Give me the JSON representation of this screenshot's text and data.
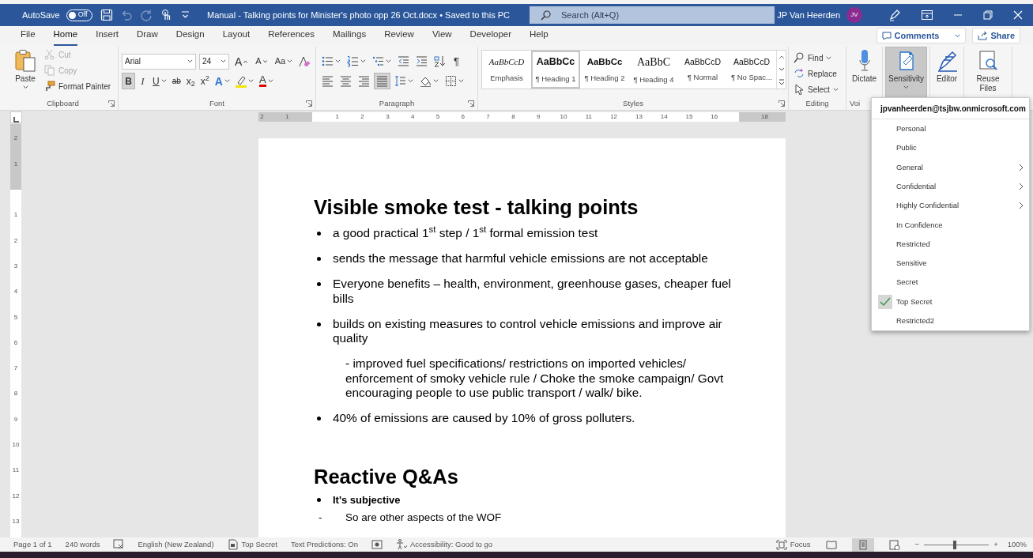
{
  "title_bar": {
    "autosave_label": "AutoSave",
    "autosave_toggle": {
      "label": "Off",
      "on": false
    },
    "quick_access": [
      {
        "kind": "save",
        "disabled": false
      },
      {
        "kind": "undo",
        "disabled": true
      },
      {
        "kind": "redo",
        "disabled": true
      },
      {
        "kind": "touch",
        "disabled": false
      },
      {
        "kind": "customize",
        "disabled": false
      }
    ],
    "document_title": "Manual - Talking points for Minister's photo opp 26 Oct.docx • Saved to this PC",
    "search": {
      "placeholder": "Search (Alt+Q)"
    },
    "user_name": "JP Van Heerden",
    "avatar_initials": "JV"
  },
  "tabs": [
    {
      "label": "File",
      "selected": false
    },
    {
      "label": "Home",
      "selected": true
    },
    {
      "label": "Insert",
      "selected": false
    },
    {
      "label": "Draw",
      "selected": false
    },
    {
      "label": "Design",
      "selected": false
    },
    {
      "label": "Layout",
      "selected": false
    },
    {
      "label": "References",
      "selected": false
    },
    {
      "label": "Mailings",
      "selected": false
    },
    {
      "label": "Review",
      "selected": false
    },
    {
      "label": "View",
      "selected": false
    },
    {
      "label": "Developer",
      "selected": false
    },
    {
      "label": "Help",
      "selected": false
    }
  ],
  "header_buttons": [
    {
      "kind": "comments",
      "label": "Comments"
    },
    {
      "kind": "share",
      "label": "Share"
    }
  ],
  "ribbon": {
    "clipboard": {
      "label": "Clipboard",
      "paste": "Paste",
      "items": [
        {
          "kind": "cut",
          "label": "Cut",
          "disabled": true
        },
        {
          "kind": "copy",
          "label": "Copy",
          "disabled": true
        },
        {
          "kind": "painter",
          "label": "Format Painter",
          "disabled": false
        }
      ]
    },
    "font": {
      "label": "Font",
      "font_name": "Arial",
      "font_size": "24",
      "size_buttons": [
        {
          "kind": "grow",
          "label": "A"
        },
        {
          "kind": "shrink",
          "label": "A"
        },
        {
          "kind": "case",
          "label": "Aa"
        }
      ],
      "buttons": [
        {
          "kind": "bold",
          "label": "B",
          "selected": true
        },
        {
          "kind": "italic",
          "label": "I",
          "selected": false
        },
        {
          "kind": "underline",
          "label": "U",
          "selected": false
        },
        {
          "kind": "strike",
          "label": "ab",
          "selected": false
        },
        {
          "kind": "subscript",
          "label": "x$_{2}$",
          "selected": false
        },
        {
          "kind": "superscript",
          "label": "x$^{2}$",
          "selected": false
        },
        {
          "kind": "effects",
          "label": "A",
          "selected": false
        },
        {
          "kind": "highlight",
          "selected": false
        },
        {
          "kind": "color",
          "label": "A",
          "selected": false
        }
      ]
    },
    "paragraph": {
      "label": "Paragraph",
      "buttons": [
        {
          "kind": "bullets",
          "selected": false
        },
        {
          "kind": "numbering",
          "selected": false
        },
        {
          "kind": "multilevel",
          "selected": false
        },
        {
          "kind": "outdent",
          "selected": false
        },
        {
          "kind": "indent",
          "selected": false
        },
        {
          "kind": "sort",
          "selected": false
        },
        {
          "kind": "pilcrow",
          "label": "¶",
          "selected": false
        },
        {
          "kind": "left",
          "selected": false
        },
        {
          "kind": "center",
          "selected": false
        },
        {
          "kind": "right",
          "selected": false
        },
        {
          "kind": "justify",
          "selected": true
        },
        {
          "kind": "spacing",
          "selected": false
        },
        {
          "kind": "shading",
          "selected": false
        },
        {
          "kind": "borders",
          "selected": false
        }
      ]
    },
    "styles": {
      "label": "Styles",
      "items": [
        {
          "kind": "emphasis",
          "preview": "AaBbCcD",
          "name": "Emphasis",
          "selected": false
        },
        {
          "kind": "heading1",
          "preview": "AaBbCc",
          "name": "¶ Heading 1",
          "selected": true
        },
        {
          "kind": "heading2",
          "preview": "AaBbCc",
          "name": "¶ Heading 2",
          "selected": false
        },
        {
          "kind": "heading4",
          "preview": "AaBbC",
          "name": "¶ Heading 4",
          "selected": false
        },
        {
          "kind": "normal",
          "preview": "AaBbCcD",
          "name": "¶ Normal",
          "selected": false
        },
        {
          "kind": "normal",
          "preview": "AaBbCcD",
          "name": "¶ No Spac...",
          "selected": false
        }
      ]
    },
    "editing": {
      "label": "Editing",
      "items": [
        {
          "kind": "find",
          "label": "Find"
        },
        {
          "kind": "replace",
          "label": "Replace"
        },
        {
          "kind": "select",
          "label": "Select"
        }
      ]
    },
    "voice": {
      "label": "Voi",
      "dictate": "Dictate"
    },
    "big_buttons": [
      {
        "kind": "sensitivity",
        "label": "Sensitivity",
        "selected": true
      },
      {
        "kind": "editor",
        "label": "Editor",
        "selected": false
      },
      {
        "kind": "reuse",
        "label": "Reuse Files",
        "selected": false
      }
    ]
  },
  "ruler": {
    "labels": [
      "2",
      "1",
      "1",
      "2",
      "3",
      "4",
      "5",
      "6",
      "7",
      "8",
      "9",
      "10",
      "11",
      "12",
      "13",
      "14",
      "15",
      "16",
      "18"
    ]
  },
  "vertical_ruler": {
    "labels": [
      "2",
      "1",
      "1",
      "2",
      "3",
      "4",
      "5",
      "6",
      "7",
      "8",
      "9",
      "10",
      "11",
      "12",
      "13"
    ]
  },
  "document": {
    "blocks": [
      {
        "kind": "heading",
        "text": "Visible smoke test - talking points"
      },
      {
        "kind": "bullet",
        "text": "a good practical 1$^{st}$ step / 1$^{st}$ formal emission test"
      },
      {
        "kind": "bullet",
        "text": "sends the message that harmful vehicle emissions are not acceptable"
      },
      {
        "kind": "bullet",
        "text": "Everyone benefits – health, environment, greenhouse gases, cheaper fuel bills"
      },
      {
        "kind": "bullet",
        "text": "builds on existing measures to control vehicle emissions and improve air quality"
      },
      {
        "kind": "indented",
        "text": "- improved fuel specifications/ restrictions on imported vehicles/ enforcement of smoky vehicle rule / Choke the smoke campaign/ Govt encouraging people to use public transport / walk/ bike."
      },
      {
        "kind": "bullet",
        "text": "40% of emissions are caused by 10% of gross polluters."
      },
      {
        "kind": "heading",
        "text": "Reactive Q&As"
      },
      {
        "kind": "small_bullet",
        "text": "It's subjective"
      },
      {
        "kind": "dash",
        "marker": "-",
        "text": "So are other aspects of the WOF"
      }
    ]
  },
  "status_bar": {
    "items": [
      {
        "kind": "page",
        "label": "Page 1 of 1"
      },
      {
        "kind": "words",
        "label": "240 words"
      },
      {
        "kind": "proofing"
      },
      {
        "kind": "language",
        "label": "English (New Zealand)"
      },
      {
        "kind": "sensitivity",
        "label": "Top Secret"
      },
      {
        "kind": "predictions",
        "label": "Text Predictions: On"
      },
      {
        "kind": "macro"
      },
      {
        "kind": "accessibility",
        "label": "Accessibility: Good to go"
      }
    ],
    "focus": "Focus",
    "views": [
      {
        "kind": "read",
        "selected": false
      },
      {
        "kind": "print",
        "selected": true
      },
      {
        "kind": "web",
        "selected": false
      }
    ],
    "zoom": {
      "minus": "−",
      "plus": "+",
      "level": 0.48,
      "reading": "100%"
    }
  },
  "sensitivity_menu": {
    "account": "jpvanheerden@tsjbw.onmicrosoft.com",
    "items": [
      {
        "label": "Personal",
        "submenu": false,
        "checked": false
      },
      {
        "label": "Public",
        "submenu": false,
        "checked": false
      },
      {
        "label": "General",
        "submenu": true,
        "checked": false
      },
      {
        "label": "Confidential",
        "submenu": true,
        "checked": false
      },
      {
        "label": "Highly Confidential",
        "submenu": true,
        "checked": false
      },
      {
        "label": "In Confidence",
        "submenu": false,
        "checked": false
      },
      {
        "label": "Restricted",
        "submenu": false,
        "checked": false
      },
      {
        "label": "Sensitive",
        "submenu": false,
        "checked": false
      },
      {
        "label": "Secret",
        "submenu": false,
        "checked": false
      },
      {
        "label": "Top Secret",
        "submenu": false,
        "checked": true
      },
      {
        "label": "Restricted2",
        "submenu": false,
        "checked": false
      }
    ]
  }
}
